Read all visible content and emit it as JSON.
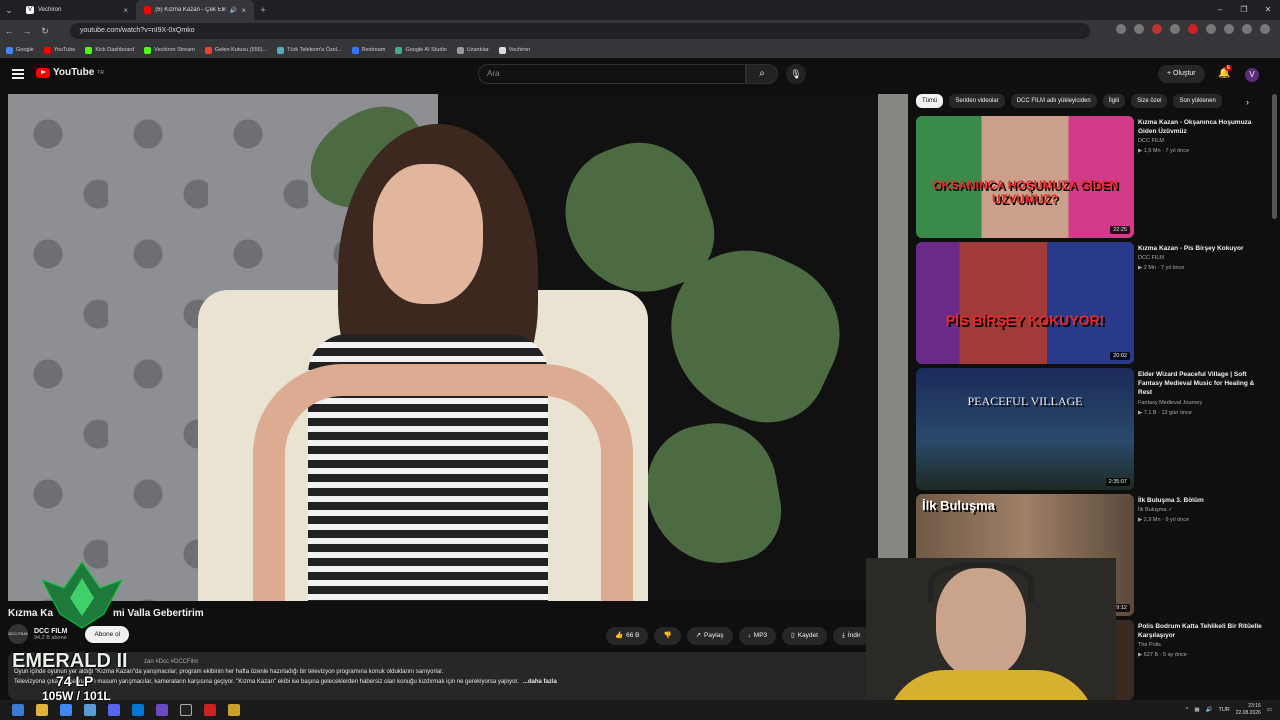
{
  "browser": {
    "tabs": [
      {
        "label": "Vechiron",
        "active": false
      },
      {
        "label": "(6) Kızma Kazan - Çek Elini",
        "active": true
      }
    ],
    "url": "youtube.com/watch?v=nI9X-0xQmko",
    "bookmarks": [
      "Google",
      "YouTube",
      "Kick Dashboard",
      "Vechiron Stream",
      "Gelen Kutusu (555)...",
      "Türk Telekom'a Özel...",
      "Restream",
      "Google AI Studio",
      "Uzantılar",
      "Vechiron"
    ]
  },
  "header": {
    "logo": "YouTube",
    "region": "TR",
    "search_placeholder": "Ara",
    "create_label": "Oluştur",
    "notif_count": "6",
    "avatar_letter": "V"
  },
  "video": {
    "title_left": "Kızma Ka",
    "title_right": "mi Valla Gebertirim",
    "channel_name": "DCC FILM",
    "channel_avatar": "DCC FILM",
    "subscribers": "94,2 B abone",
    "subscribe_label": "Abone ol",
    "likes": "66 B",
    "share_label": "Paylaş",
    "mp3_label": "MP3",
    "save_label": "Kaydet",
    "download_label": "İndir",
    "more_label": "•••"
  },
  "description": {
    "tags": "zan #Dcc #DCCFilm",
    "line1": "Oyun içinde oyunun yer aldığı \"Kızma Kazan\"da yarışmacılar; program ekibinin her hafta özenle hazırladığı bir televizyon programına konuk olduklarını sanıyorlar.",
    "line2": "Televizyona çıkacağına inanan masum yarışmacılar, kameraların karşısına geçiyor. \"Kızma Kazan\" ekibi ise başına geleceklerden habersiz olan konuğu kızdırmak için ne gerekiyorsa yapıyor.",
    "more": "...daha fazla"
  },
  "overlay": {
    "rank": "EMERALD II",
    "lp": "74 LP",
    "wl": "105W / 101L"
  },
  "chips": [
    "Tümü",
    "Seriden videolar",
    "DCC FILM adlı yükleyiciden",
    "İlgili",
    "Size özel",
    "Son yüklenen"
  ],
  "recommendations": [
    {
      "title": "Kızma Kazan - Okşanınca Hoşumuza Giden Üzüvmüz",
      "channel": "DCC FILM",
      "meta": "▶ 1,6 Mn · 7 yıl önce",
      "duration": "22:25",
      "thumb_text": "OKSANINCA HOŞUMUZA GİDEN UZVUMUZ?"
    },
    {
      "title": "Kızma Kazan - Pis Birşey Kokuyor",
      "channel": "DCC FILM",
      "meta": "▶ 2 Mn · 7 yıl önce",
      "duration": "20:02",
      "thumb_text": "PİS BİRŞEY KOKUYOR!"
    },
    {
      "title": "Elder Wizard Peaceful Village | Soft Fantasy Medieval Music for Healing & Rest",
      "channel": "Fantasy Medieval Journey",
      "meta": "▶ 7,1 B · 12 gün önce",
      "duration": "2:35:07",
      "thumb_text": "PEACEFUL VILLAGE"
    },
    {
      "title": "İlk Buluşma 3. Bölüm",
      "channel": "İlk Buluşma ✓",
      "meta": "▶ 2,9 Mn · 9 yıl önce",
      "duration": "1:19:12",
      "thumb_text": "İlk Buluşma"
    },
    {
      "title": "Polis Bodrum Katta Tehlikeli Bir Ritüelle Karşılaşıyor",
      "channel": "The Polis",
      "meta": "▶ 627 B · 5 ay önce",
      "duration": "",
      "thumb_text": ""
    }
  ],
  "taskbar": {
    "lang": "TUR",
    "time": "23:16",
    "date": "22.08.2026"
  },
  "colors": {
    "brand": "#ff0000",
    "bg": "#0f0f0f",
    "chip_active": "#f1f1f1"
  }
}
